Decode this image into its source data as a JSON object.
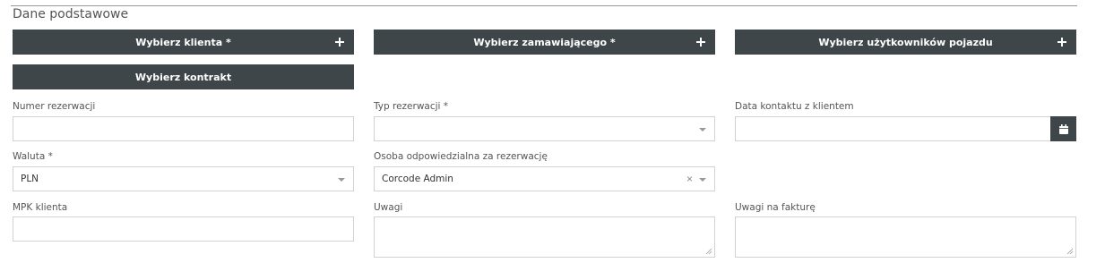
{
  "section": {
    "title": "Dane podstawowe"
  },
  "buttons": {
    "client": "Wybierz klienta *",
    "orderer": "Wybierz zamawiającego *",
    "vehicle_users": "Wybierz użytkowników pojazdu",
    "contract": "Wybierz kontrakt"
  },
  "fields": {
    "reservation_number": {
      "label": "Numer rezerwacji",
      "value": ""
    },
    "reservation_type": {
      "label": "Typ rezerwacji *",
      "value": ""
    },
    "contact_date": {
      "label": "Data kontaktu z klientem",
      "value": ""
    },
    "currency": {
      "label": "Waluta *",
      "value": "PLN"
    },
    "responsible_person": {
      "label": "Osoba odpowiedzialna za rezerwację",
      "value": "Corcode Admin",
      "clear": "×"
    },
    "client_mpk": {
      "label": "MPK klienta",
      "value": ""
    },
    "notes": {
      "label": "Uwagi",
      "value": ""
    },
    "invoice_notes": {
      "label": "Uwagi na fakturę",
      "value": ""
    }
  },
  "colors": {
    "button_bg": "#3f4649",
    "border": "#cfd3d6"
  }
}
